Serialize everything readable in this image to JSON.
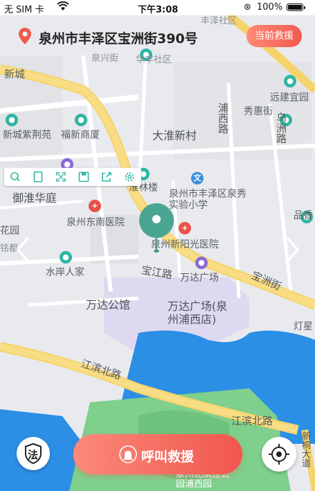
{
  "status_bar": {
    "carrier": "无 SIM 卡",
    "time": "下午3:08",
    "battery": "100%"
  },
  "address_bar": {
    "address": "泉州市丰泽区宝洲街390号",
    "rescue_button": "当前救援"
  },
  "map": {
    "labels": {
      "fengze_community_top": "丰泽社区",
      "quanxing_street": "泉兴街",
      "huafeng_community": "华丰社区",
      "xincheng": "新城",
      "yuanjian_yiyuan": "远建宜园",
      "puxi_road": "浦西路",
      "xiuhui_street": "秀惠街",
      "wuzhou_road": "乌洲路",
      "xincheng_zijingyuan": "新城紫荆苑",
      "fuxin_mall": "福新商厦",
      "dahuai_village": "大淮新村",
      "huailin_building": "淮林楼",
      "quanxiu_school": "泉州市丰泽区泉秀实验小学",
      "yuhuai_huating": "御淮华庭",
      "dongnan_hospital": "泉州东南医院",
      "xinyang_hospital": "泉州新阳光医院",
      "pinxiang": "品香",
      "huayuan": "花园",
      "mingdu": "铭都",
      "shuian_renjia": "水岸人家",
      "baojiang_road": "宝江路",
      "wanda_plaza_small": "万达广场",
      "baozhou_street": "宝洲街",
      "wanda_gongguan": "万达公馆",
      "wanda_plaza_big": "万达广场(泉州浦西店)",
      "dengxing": "灯星",
      "jiangbin_north_road": "江滨北路",
      "jiangbin_north_road_2": "江滨北路",
      "park": "泉州北滨江公园浦西园",
      "right_road": "新桐大道"
    }
  },
  "toolbar": {
    "icons": [
      "search-icon",
      "page-icon",
      "fullscreen-icon",
      "save-icon",
      "share-icon",
      "settings-icon"
    ]
  },
  "bottom": {
    "law_label": "法",
    "call_button": "呼叫救援"
  },
  "colors": {
    "accent": "#f15a50",
    "teal": "#2fb5a3",
    "road_yellow": "#f5d36b",
    "water": "#2b8fe6",
    "park_green": "#7fcf8d"
  }
}
